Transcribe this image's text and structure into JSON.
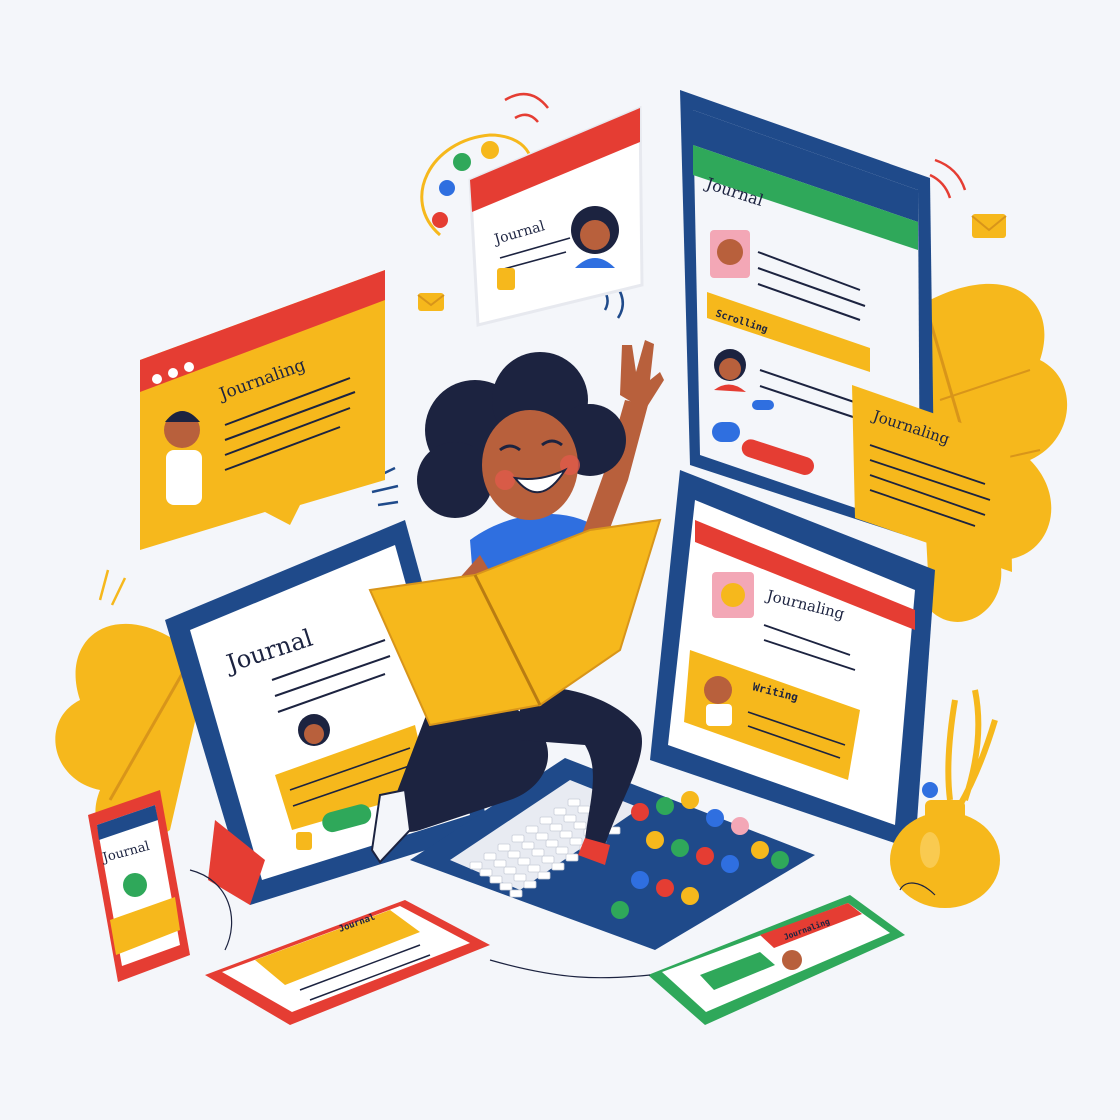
{
  "colors": {
    "background": "#f4f6fa",
    "navy": "#1f4a8a",
    "red": "#e53d33",
    "yellow": "#f6b81c",
    "green": "#2fa85a",
    "blue": "#2f6fe0",
    "skin": "#b8603c",
    "ink": "#1c2340"
  },
  "screens": {
    "speech_left_title": "Journaling",
    "browser_small_title": "Journal",
    "tablet_tall_title": "Journal",
    "tablet_tall_section": "Scrolling",
    "card_right_title": "Journaling",
    "tablet_left_title": "Journal",
    "tablet_right_title": "Journaling",
    "tablet_right_section": "Writing",
    "phone_left_title": "Journal",
    "phone_bottom_title": "Journal",
    "phone_right_title": "Journaling"
  },
  "icons": [
    "palette-icon",
    "envelope-icon",
    "keyboard-icon",
    "leaf-icon",
    "vase-icon",
    "book-icon"
  ]
}
